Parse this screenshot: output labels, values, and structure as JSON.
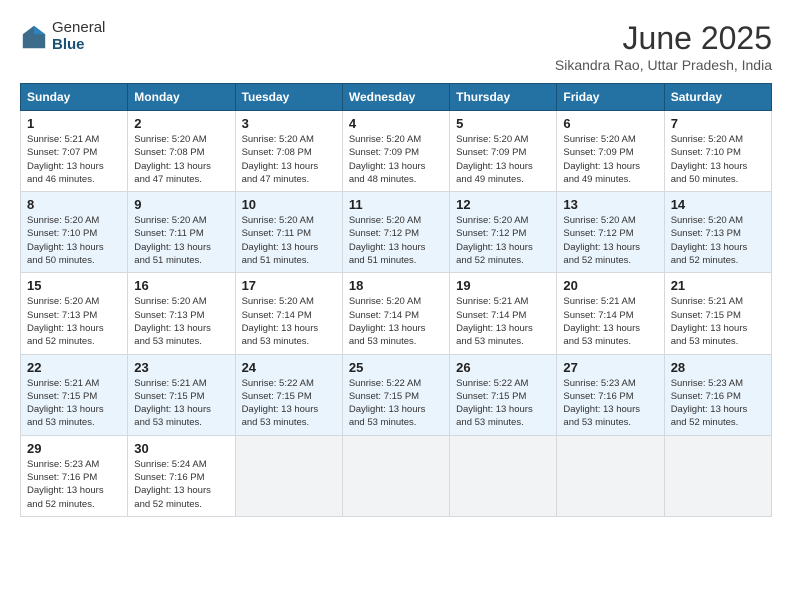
{
  "logo": {
    "general": "General",
    "blue": "Blue"
  },
  "header": {
    "month": "June 2025",
    "location": "Sikandra Rao, Uttar Pradesh, India"
  },
  "days_of_week": [
    "Sunday",
    "Monday",
    "Tuesday",
    "Wednesday",
    "Thursday",
    "Friday",
    "Saturday"
  ],
  "weeks": [
    [
      {
        "day": "1",
        "sunrise": "5:21 AM",
        "sunset": "7:07 PM",
        "daylight": "13 hours and 46 minutes."
      },
      {
        "day": "2",
        "sunrise": "5:20 AM",
        "sunset": "7:08 PM",
        "daylight": "13 hours and 47 minutes."
      },
      {
        "day": "3",
        "sunrise": "5:20 AM",
        "sunset": "7:08 PM",
        "daylight": "13 hours and 47 minutes."
      },
      {
        "day": "4",
        "sunrise": "5:20 AM",
        "sunset": "7:09 PM",
        "daylight": "13 hours and 48 minutes."
      },
      {
        "day": "5",
        "sunrise": "5:20 AM",
        "sunset": "7:09 PM",
        "daylight": "13 hours and 49 minutes."
      },
      {
        "day": "6",
        "sunrise": "5:20 AM",
        "sunset": "7:09 PM",
        "daylight": "13 hours and 49 minutes."
      },
      {
        "day": "7",
        "sunrise": "5:20 AM",
        "sunset": "7:10 PM",
        "daylight": "13 hours and 50 minutes."
      }
    ],
    [
      {
        "day": "8",
        "sunrise": "5:20 AM",
        "sunset": "7:10 PM",
        "daylight": "13 hours and 50 minutes."
      },
      {
        "day": "9",
        "sunrise": "5:20 AM",
        "sunset": "7:11 PM",
        "daylight": "13 hours and 51 minutes."
      },
      {
        "day": "10",
        "sunrise": "5:20 AM",
        "sunset": "7:11 PM",
        "daylight": "13 hours and 51 minutes."
      },
      {
        "day": "11",
        "sunrise": "5:20 AM",
        "sunset": "7:12 PM",
        "daylight": "13 hours and 51 minutes."
      },
      {
        "day": "12",
        "sunrise": "5:20 AM",
        "sunset": "7:12 PM",
        "daylight": "13 hours and 52 minutes."
      },
      {
        "day": "13",
        "sunrise": "5:20 AM",
        "sunset": "7:12 PM",
        "daylight": "13 hours and 52 minutes."
      },
      {
        "day": "14",
        "sunrise": "5:20 AM",
        "sunset": "7:13 PM",
        "daylight": "13 hours and 52 minutes."
      }
    ],
    [
      {
        "day": "15",
        "sunrise": "5:20 AM",
        "sunset": "7:13 PM",
        "daylight": "13 hours and 52 minutes."
      },
      {
        "day": "16",
        "sunrise": "5:20 AM",
        "sunset": "7:13 PM",
        "daylight": "13 hours and 53 minutes."
      },
      {
        "day": "17",
        "sunrise": "5:20 AM",
        "sunset": "7:14 PM",
        "daylight": "13 hours and 53 minutes."
      },
      {
        "day": "18",
        "sunrise": "5:20 AM",
        "sunset": "7:14 PM",
        "daylight": "13 hours and 53 minutes."
      },
      {
        "day": "19",
        "sunrise": "5:21 AM",
        "sunset": "7:14 PM",
        "daylight": "13 hours and 53 minutes."
      },
      {
        "day": "20",
        "sunrise": "5:21 AM",
        "sunset": "7:14 PM",
        "daylight": "13 hours and 53 minutes."
      },
      {
        "day": "21",
        "sunrise": "5:21 AM",
        "sunset": "7:15 PM",
        "daylight": "13 hours and 53 minutes."
      }
    ],
    [
      {
        "day": "22",
        "sunrise": "5:21 AM",
        "sunset": "7:15 PM",
        "daylight": "13 hours and 53 minutes."
      },
      {
        "day": "23",
        "sunrise": "5:21 AM",
        "sunset": "7:15 PM",
        "daylight": "13 hours and 53 minutes."
      },
      {
        "day": "24",
        "sunrise": "5:22 AM",
        "sunset": "7:15 PM",
        "daylight": "13 hours and 53 minutes."
      },
      {
        "day": "25",
        "sunrise": "5:22 AM",
        "sunset": "7:15 PM",
        "daylight": "13 hours and 53 minutes."
      },
      {
        "day": "26",
        "sunrise": "5:22 AM",
        "sunset": "7:15 PM",
        "daylight": "13 hours and 53 minutes."
      },
      {
        "day": "27",
        "sunrise": "5:23 AM",
        "sunset": "7:16 PM",
        "daylight": "13 hours and 53 minutes."
      },
      {
        "day": "28",
        "sunrise": "5:23 AM",
        "sunset": "7:16 PM",
        "daylight": "13 hours and 52 minutes."
      }
    ],
    [
      {
        "day": "29",
        "sunrise": "5:23 AM",
        "sunset": "7:16 PM",
        "daylight": "13 hours and 52 minutes."
      },
      {
        "day": "30",
        "sunrise": "5:24 AM",
        "sunset": "7:16 PM",
        "daylight": "13 hours and 52 minutes."
      },
      null,
      null,
      null,
      null,
      null
    ]
  ]
}
